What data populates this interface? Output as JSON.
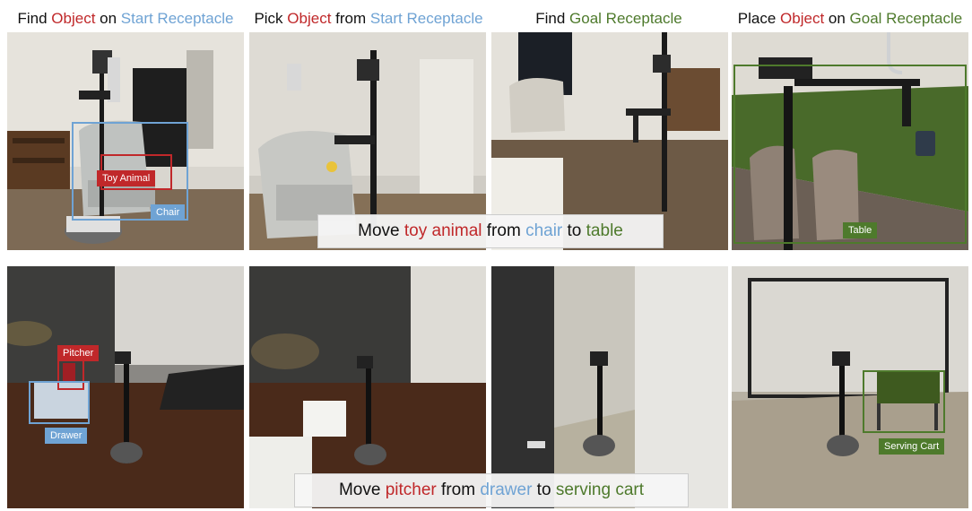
{
  "headers": [
    {
      "a": "Find ",
      "b": "Object",
      "c": " on ",
      "d": "Start Receptacle"
    },
    {
      "a": "Pick ",
      "b": "Object",
      "c": " from ",
      "d": "Start Receptacle"
    },
    {
      "a": "Find ",
      "d": "Goal Receptacle"
    },
    {
      "a": "Place ",
      "b": "Object",
      "c": " on ",
      "d": "Goal Receptacle"
    }
  ],
  "row1": {
    "labels": {
      "object": "Toy Animal",
      "start": "Chair",
      "goal": "Table"
    },
    "caption": {
      "p1": "Move ",
      "obj": "toy animal",
      "p2": " from ",
      "start": "chair",
      "p3": " to ",
      "goal": "table"
    }
  },
  "row2": {
    "labels": {
      "object": "Pitcher",
      "start": "Drawer",
      "goal": "Serving Cart"
    },
    "caption": {
      "p1": "Move ",
      "obj": "pitcher",
      "p2": " from ",
      "start": "drawer",
      "p3": " to ",
      "goal": "serving cart"
    }
  },
  "colors": {
    "object": "#c0282a",
    "start": "#6fa3d4",
    "goal": "#4e7a2c"
  }
}
